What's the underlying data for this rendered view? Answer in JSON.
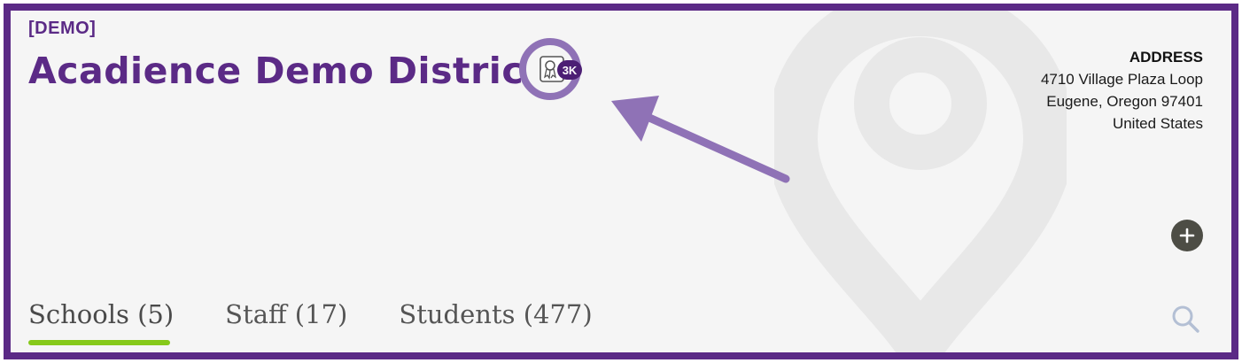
{
  "header": {
    "tag": "[DEMO]",
    "title": "Acadience Demo District",
    "badge_count": "3K",
    "badge_icon": "certificate-icon"
  },
  "address": {
    "heading": "ADDRESS",
    "line1": "4710 Village Plaza Loop",
    "line2": "Eugene, Oregon 97401",
    "line3": "United States"
  },
  "tabs": [
    {
      "label": "Schools (5)",
      "active": true
    },
    {
      "label": "Staff (17)",
      "active": false
    },
    {
      "label": "Students (477)",
      "active": false
    }
  ],
  "icons": {
    "add": "plus-icon",
    "search": "search-icon",
    "watermark": "map-pin-icon"
  },
  "colors": {
    "brand": "#5b2a86",
    "badge_ring": "#8f72b6",
    "active_tab_underline": "#86c91a",
    "add_button": "#4d4d45",
    "search_icon": "#b3bfd4"
  }
}
